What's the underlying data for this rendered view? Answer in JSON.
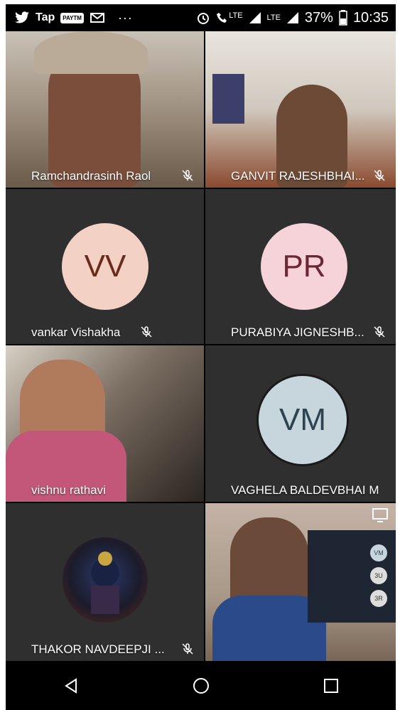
{
  "status_bar": {
    "apps": [
      "twitter-icon",
      "tap-icon",
      "paytm-icon",
      "gmail-icon"
    ],
    "tap_label": "Tap",
    "paytm_label": "PAYTM",
    "overflow": "···",
    "network_label": "LTE",
    "network_label_2": "LTE",
    "battery": "37%",
    "time": "10:35"
  },
  "participants": [
    {
      "name": "Ramchandrasinh Raol",
      "muted": true,
      "type": "video"
    },
    {
      "name": "GANVIT RAJESHBHAI...",
      "muted": true,
      "type": "video"
    },
    {
      "name": "vankar Vishakha",
      "initials": "VV",
      "muted": true,
      "type": "avatar",
      "bg": "#f3d1c5",
      "fg": "#6b2a1c"
    },
    {
      "name": "PURABIYA JIGNESHB...",
      "initials": "PR",
      "muted": true,
      "type": "avatar",
      "bg": "#f6d3d9",
      "fg": "#6b2733"
    },
    {
      "name": "vishnu rathavi",
      "muted": false,
      "type": "video"
    },
    {
      "name": "VAGHELA BALDEVBHAI M",
      "initials": "VM",
      "muted": false,
      "type": "avatar",
      "bg": "#c7d6dd",
      "fg": "#2d4450"
    },
    {
      "name": "THAKOR NAVDEEPJI ...",
      "muted": true,
      "type": "photo-avatar"
    },
    {
      "name": "",
      "muted": false,
      "type": "video"
    }
  ],
  "screen_share": {
    "mini_tiles": [
      "VM",
      "3U",
      "3R"
    ]
  },
  "nav": [
    "back-icon",
    "home-icon",
    "recents-icon"
  ]
}
